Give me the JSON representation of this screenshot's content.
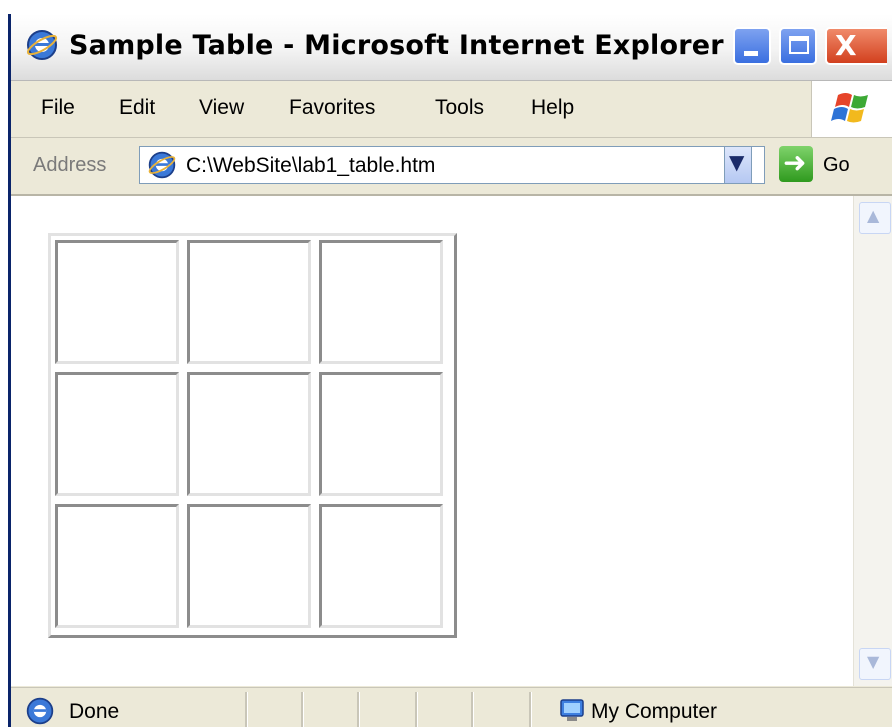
{
  "window": {
    "title": "Sample Table - Microsoft Internet Explorer",
    "controls": {
      "minimize": "_",
      "maximize": "",
      "close": "X"
    }
  },
  "menubar": {
    "items": [
      {
        "label": "File"
      },
      {
        "label": "Edit"
      },
      {
        "label": "View"
      },
      {
        "label": "Favorites"
      },
      {
        "label": "Tools"
      },
      {
        "label": "Help"
      }
    ]
  },
  "addressbar": {
    "label": "Address",
    "url": "C:\\WebSite\\lab1_table.htm",
    "go_label": "Go"
  },
  "table": {
    "rows": [
      [
        "",
        "",
        ""
      ],
      [
        "",
        "",
        ""
      ],
      [
        "",
        "",
        ""
      ]
    ]
  },
  "statusbar": {
    "status": "Done",
    "zone": "My Computer"
  },
  "colors": {
    "titlebar": "#f3f3f3",
    "chrome": "#ece9d8",
    "window_border": "#0a246a",
    "close_button": "#d2401e",
    "min_max_button": "#3a6fe0",
    "go_button": "#2f9a1e"
  },
  "icons": [
    "ie-logo-icon",
    "minimize-icon",
    "maximize-icon",
    "close-icon",
    "windows-logo-icon",
    "dropdown-arrow-icon",
    "go-arrow-icon",
    "scroll-up-icon",
    "scroll-down-icon",
    "my-computer-icon"
  ]
}
